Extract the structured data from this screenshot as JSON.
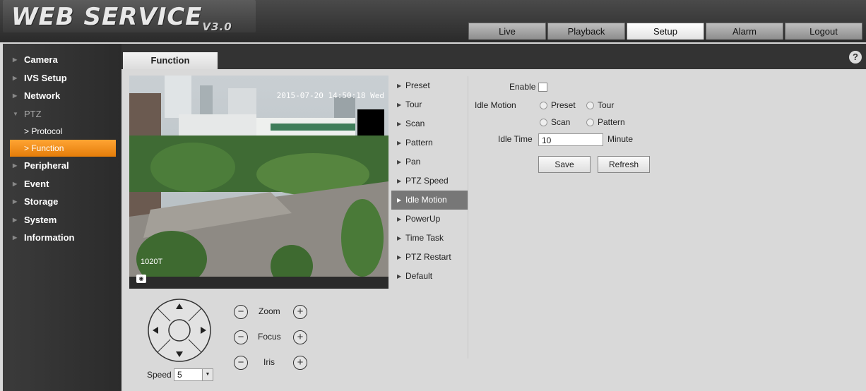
{
  "logo": {
    "main": "WEB SERVICE",
    "version": "V3.0"
  },
  "top_tabs": [
    "Live",
    "Playback",
    "Setup",
    "Alarm",
    "Logout"
  ],
  "active_top_tab": "Setup",
  "nav": {
    "items": [
      "Camera",
      "IVS Setup",
      "Network",
      "PTZ",
      "Peripheral",
      "Event",
      "Storage",
      "System",
      "Information"
    ],
    "ptz_sub": [
      "Protocol",
      "Function"
    ]
  },
  "content": {
    "tab_label": "Function",
    "help_icon": "?",
    "video": {
      "timestamp": "2015-07-20 14:50:18 Wed",
      "channel": "1020T"
    }
  },
  "menu": [
    "Preset",
    "Tour",
    "Scan",
    "Pattern",
    "Pan",
    "PTZ Speed",
    "Idle Motion",
    "PowerUp",
    "Time Task",
    "PTZ Restart",
    "Default"
  ],
  "active_menu": "Idle Motion",
  "form": {
    "enable_label": "Enable",
    "idle_motion_label": "Idle Motion",
    "options": [
      "Preset",
      "Tour",
      "Scan",
      "Pattern"
    ],
    "idle_time_label": "Idle Time",
    "idle_time_value": "10",
    "unit": "Minute",
    "save": "Save",
    "refresh": "Refresh"
  },
  "ptz": {
    "zoom": "Zoom",
    "focus": "Focus",
    "iris": "Iris",
    "minus": "−",
    "plus": "+",
    "speed_label": "Speed",
    "speed_value": "5"
  }
}
